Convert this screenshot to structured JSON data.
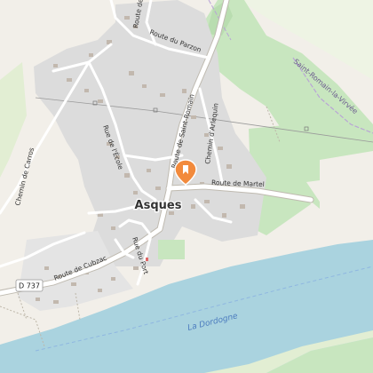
{
  "map": {
    "place_label": "Asques",
    "locality_label": "Saint-Romain-la-Virvée",
    "river_label": "La Dordogne",
    "route_shield": "D 737",
    "roads": {
      "route_cubzac": "Route de Cubzac",
      "route_saint_romain": "Route de Saint-Romain",
      "route_martel": "Route de Martel",
      "route_parzon": "Route du Parzon",
      "rue_ecole": "Rue de l'École",
      "rue_port": "Rue du Port",
      "chemin_arlequin": "Chemin d'Arlequin",
      "chemin_carros": "Chemin de Carros",
      "route_top": "Route de S"
    },
    "marker_icon": "poi-marker-icon",
    "colors": {
      "water": "#aad3df",
      "vineyard": "#c8e6bf",
      "built": "#dcdcdc",
      "marker": "#f28a3c"
    }
  }
}
